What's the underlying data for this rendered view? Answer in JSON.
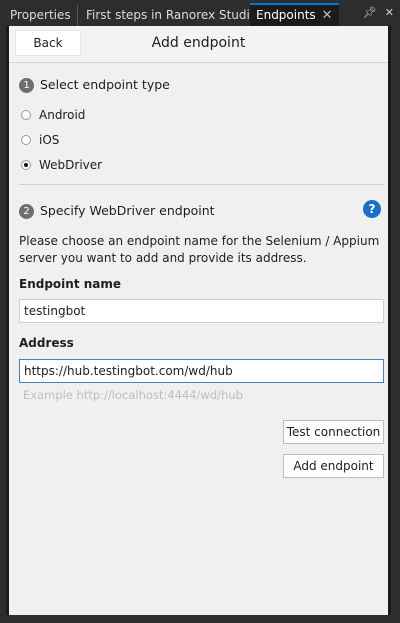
{
  "tabs": [
    {
      "label": "Properties"
    },
    {
      "label": "First steps in Ranorex Studio"
    },
    {
      "label": "Endpoints"
    }
  ],
  "tab_tools": {
    "pin_icon": "pin-icon",
    "menu_icon": "close-panel-icon"
  },
  "header": {
    "back_label": "Back",
    "title": "Add endpoint"
  },
  "step1": {
    "number": "1",
    "heading": "Select endpoint type",
    "options": [
      {
        "label": "Android",
        "checked": false
      },
      {
        "label": "iOS",
        "checked": false
      },
      {
        "label": "WebDriver",
        "checked": true
      }
    ]
  },
  "step2": {
    "number": "2",
    "heading": "Specify WebDriver endpoint",
    "help": "?",
    "description": "Please choose an endpoint name for the Selenium / Appium server you want to add and provide its address."
  },
  "fields": {
    "endpoint_name_label": "Endpoint name",
    "endpoint_name_value": "testingbot",
    "address_label": "Address",
    "address_value": "https://hub.testingbot.com/wd/hub",
    "address_hint": "Example http://localhost:4444/wd/hub"
  },
  "buttons": {
    "test_connection": "Test connection",
    "add_endpoint": "Add endpoint"
  },
  "colors": {
    "accent": "#0078d7",
    "help_icon": "#1a6fc9",
    "panel_bg": "#f0f0f0",
    "chrome_bg": "#2d2d2d"
  }
}
